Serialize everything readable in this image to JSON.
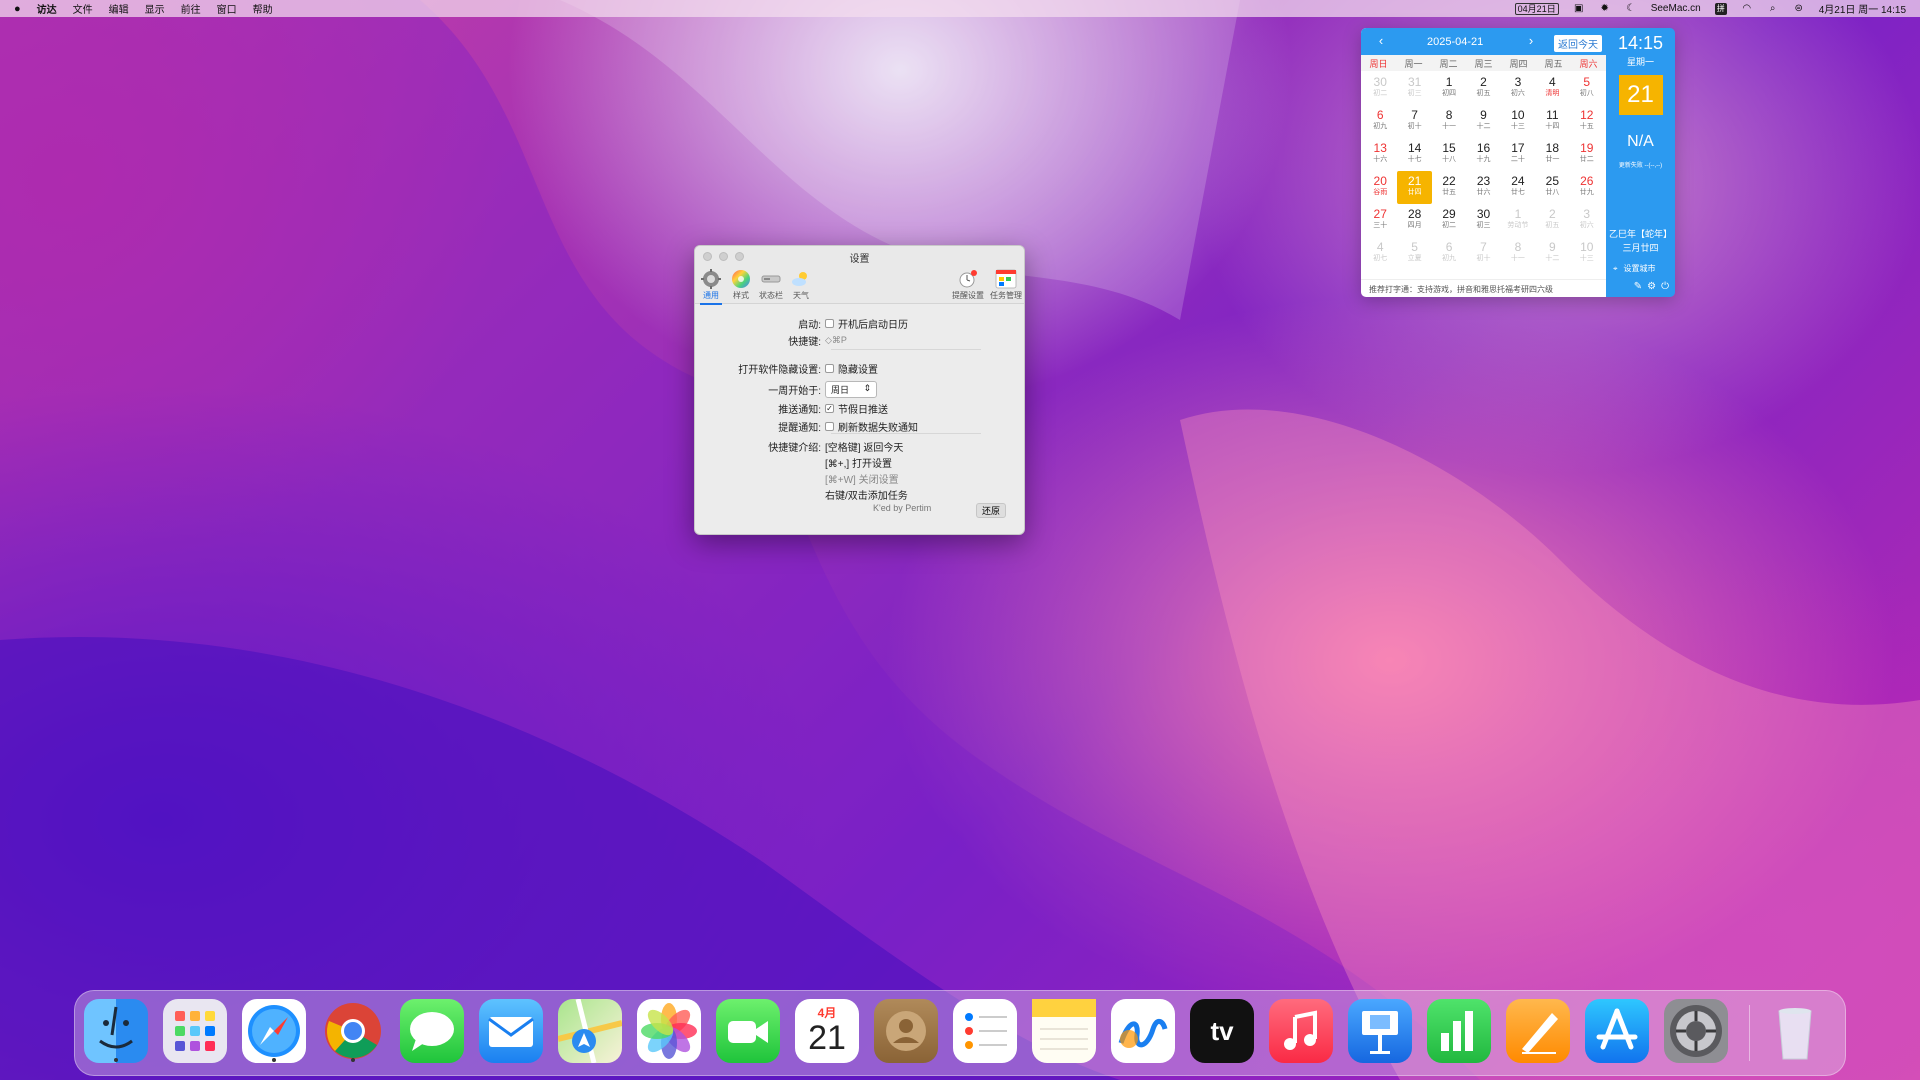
{
  "menubar": {
    "items": [
      "访达",
      "文件",
      "编辑",
      "显示",
      "前往",
      "窗口",
      "帮助"
    ],
    "date_badge": "04月21日",
    "brand": "SeeMac.cn",
    "ime": "拼",
    "clock": "4月21日 周一 14:15",
    "icons": [
      "apple-icon",
      "calendar-badge-icon",
      "notes-icon",
      "brightness-icon",
      "do-not-disturb-icon",
      "ime-icon",
      "wifi-icon",
      "search-icon",
      "control-center-icon"
    ]
  },
  "calendar": {
    "year_month": "2025-04-21",
    "today_button": "返回今天",
    "weekdays": [
      "周日",
      "周一",
      "周二",
      "周三",
      "周四",
      "周五",
      "周六"
    ],
    "days": [
      {
        "d": "30",
        "l": "初二",
        "t": "other"
      },
      {
        "d": "31",
        "l": "初三",
        "t": "other"
      },
      {
        "d": "1",
        "l": "初四"
      },
      {
        "d": "2",
        "l": "初五"
      },
      {
        "d": "3",
        "l": "初六"
      },
      {
        "d": "4",
        "l": "清明",
        "t": "hl"
      },
      {
        "d": "5",
        "l": "初八",
        "t": "red"
      },
      {
        "d": "6",
        "l": "初九",
        "t": "red"
      },
      {
        "d": "7",
        "l": "初十"
      },
      {
        "d": "8",
        "l": "十一"
      },
      {
        "d": "9",
        "l": "十二"
      },
      {
        "d": "10",
        "l": "十三"
      },
      {
        "d": "11",
        "l": "十四"
      },
      {
        "d": "12",
        "l": "十五",
        "t": "red"
      },
      {
        "d": "13",
        "l": "十六",
        "t": "red"
      },
      {
        "d": "14",
        "l": "十七"
      },
      {
        "d": "15",
        "l": "十八"
      },
      {
        "d": "16",
        "l": "十九"
      },
      {
        "d": "17",
        "l": "二十"
      },
      {
        "d": "18",
        "l": "廿一"
      },
      {
        "d": "19",
        "l": "廿二",
        "t": "red"
      },
      {
        "d": "20",
        "l": "谷雨",
        "t": "red hl"
      },
      {
        "d": "21",
        "l": "廿四",
        "t": "today"
      },
      {
        "d": "22",
        "l": "廿五"
      },
      {
        "d": "23",
        "l": "廿六"
      },
      {
        "d": "24",
        "l": "廿七"
      },
      {
        "d": "25",
        "l": "廿八"
      },
      {
        "d": "26",
        "l": "廿九",
        "t": "red"
      },
      {
        "d": "27",
        "l": "三十",
        "t": "red"
      },
      {
        "d": "28",
        "l": "四月"
      },
      {
        "d": "29",
        "l": "初二"
      },
      {
        "d": "30",
        "l": "初三"
      },
      {
        "d": "1",
        "l": "劳动节",
        "t": "other"
      },
      {
        "d": "2",
        "l": "初五",
        "t": "other"
      },
      {
        "d": "3",
        "l": "初六",
        "t": "other"
      },
      {
        "d": "4",
        "l": "初七",
        "t": "other"
      },
      {
        "d": "5",
        "l": "立夏",
        "t": "other"
      },
      {
        "d": "6",
        "l": "初九",
        "t": "other"
      },
      {
        "d": "7",
        "l": "初十",
        "t": "other"
      },
      {
        "d": "8",
        "l": "十一",
        "t": "other"
      },
      {
        "d": "9",
        "l": "十二",
        "t": "other"
      },
      {
        "d": "10",
        "l": "十三",
        "t": "other"
      }
    ],
    "footer": "推荐打字通：支持游戏，拼音和雅思托福考研四六级",
    "side": {
      "time": "14:15",
      "weekday": "星期一",
      "day": "21",
      "weather": "N/A",
      "weather_tip": "更新失败 --(--,--)",
      "lunar_year": "乙巳年【蛇年】",
      "lunar_date": "三月廿四",
      "city": "设置城市"
    }
  },
  "settings": {
    "title": "设置",
    "toolbar": [
      "通用",
      "样式",
      "状态栏",
      "天气",
      "提醒设置",
      "任务管理"
    ],
    "rows": {
      "startup_label": "启动:",
      "startup_option": "开机后启动日历",
      "hotkey_label": "快捷键:",
      "hotkey_value": "◇⌘P",
      "hide_label": "打开软件隐藏设置:",
      "hide_option": "隐藏设置",
      "week_label": "一周开始于:",
      "week_value": "周日",
      "push_label": "推送通知:",
      "push_option": "节假日推送",
      "remind_label": "提醒通知:",
      "remind_option": "刷新数据失败通知",
      "shortcut_label": "快捷键介绍:",
      "shortcut_1": "[空格键] 返回今天",
      "shortcut_2": "[⌘+,] 打开设置",
      "shortcut_3": "[⌘+W] 关闭设置",
      "shortcut_4": "右键/双击添加任务"
    },
    "credit": "K'ed by Pertim",
    "restore": "还原"
  },
  "dock": {
    "apps": [
      "finder",
      "launchpad",
      "safari",
      "chrome",
      "messages",
      "mail",
      "maps",
      "photos",
      "facetime",
      "calendar",
      "contacts",
      "reminders",
      "notes",
      "freeform",
      "apple-tv",
      "music",
      "keynote",
      "numbers",
      "pages",
      "app-store",
      "system-settings",
      "trash"
    ],
    "calendar_month": "4月",
    "calendar_day": "21",
    "tv_label": "tv"
  }
}
